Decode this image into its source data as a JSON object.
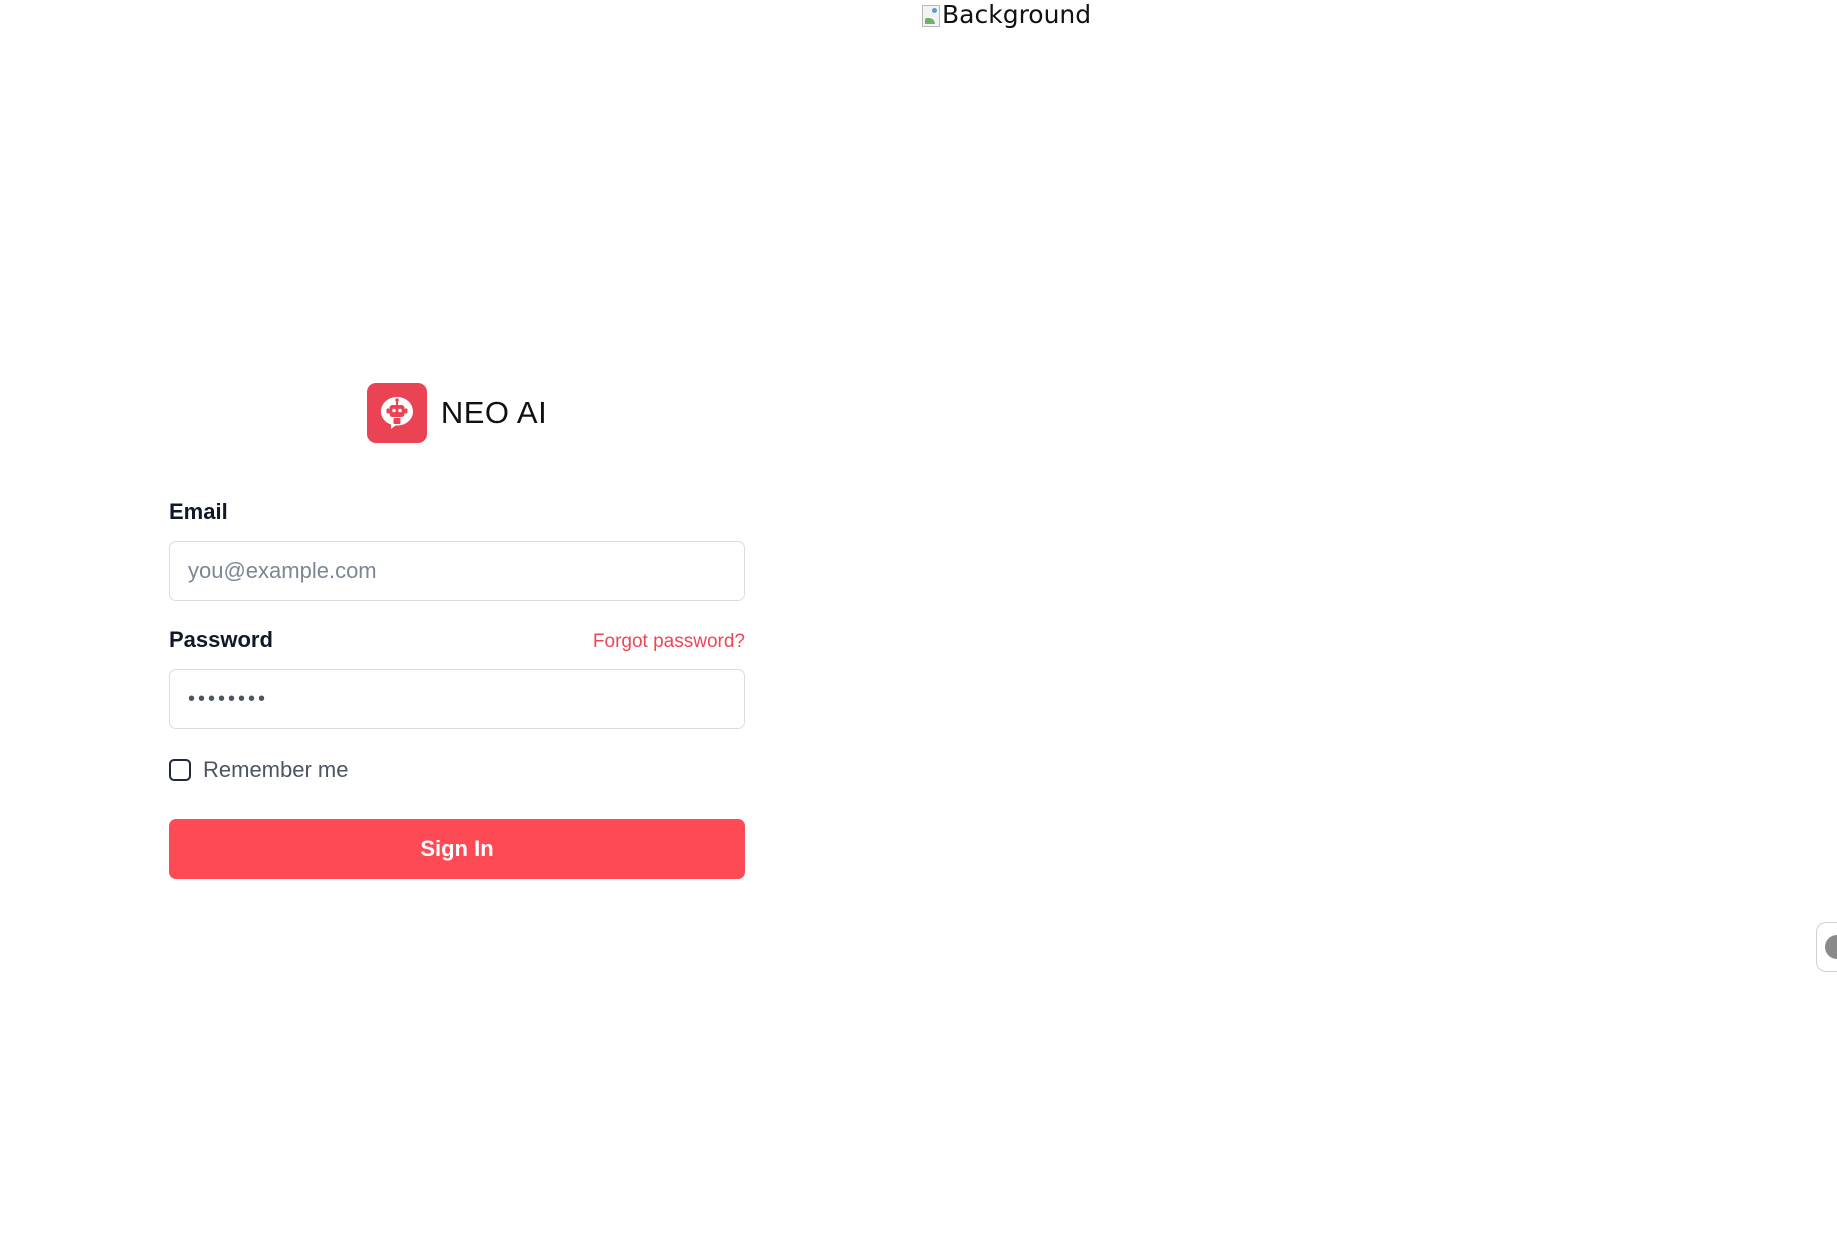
{
  "background_image": {
    "alt_text": "Background",
    "icon": "broken-image-icon"
  },
  "brand": {
    "name": "NEO AI",
    "logo_icon": "robot-chat-icon",
    "logo_color": "#ea4454"
  },
  "form": {
    "email": {
      "label": "Email",
      "placeholder": "you@example.com",
      "value": ""
    },
    "password": {
      "label": "Password",
      "forgot_link": "Forgot password?",
      "value": "••••••••"
    },
    "remember": {
      "label": "Remember me",
      "checked": false
    },
    "submit_label": "Sign In"
  },
  "side_widget": {
    "icon": "circle-widget-icon"
  },
  "colors": {
    "accent": "#fe4a55",
    "link": "#ef4655",
    "text": "#111827"
  }
}
